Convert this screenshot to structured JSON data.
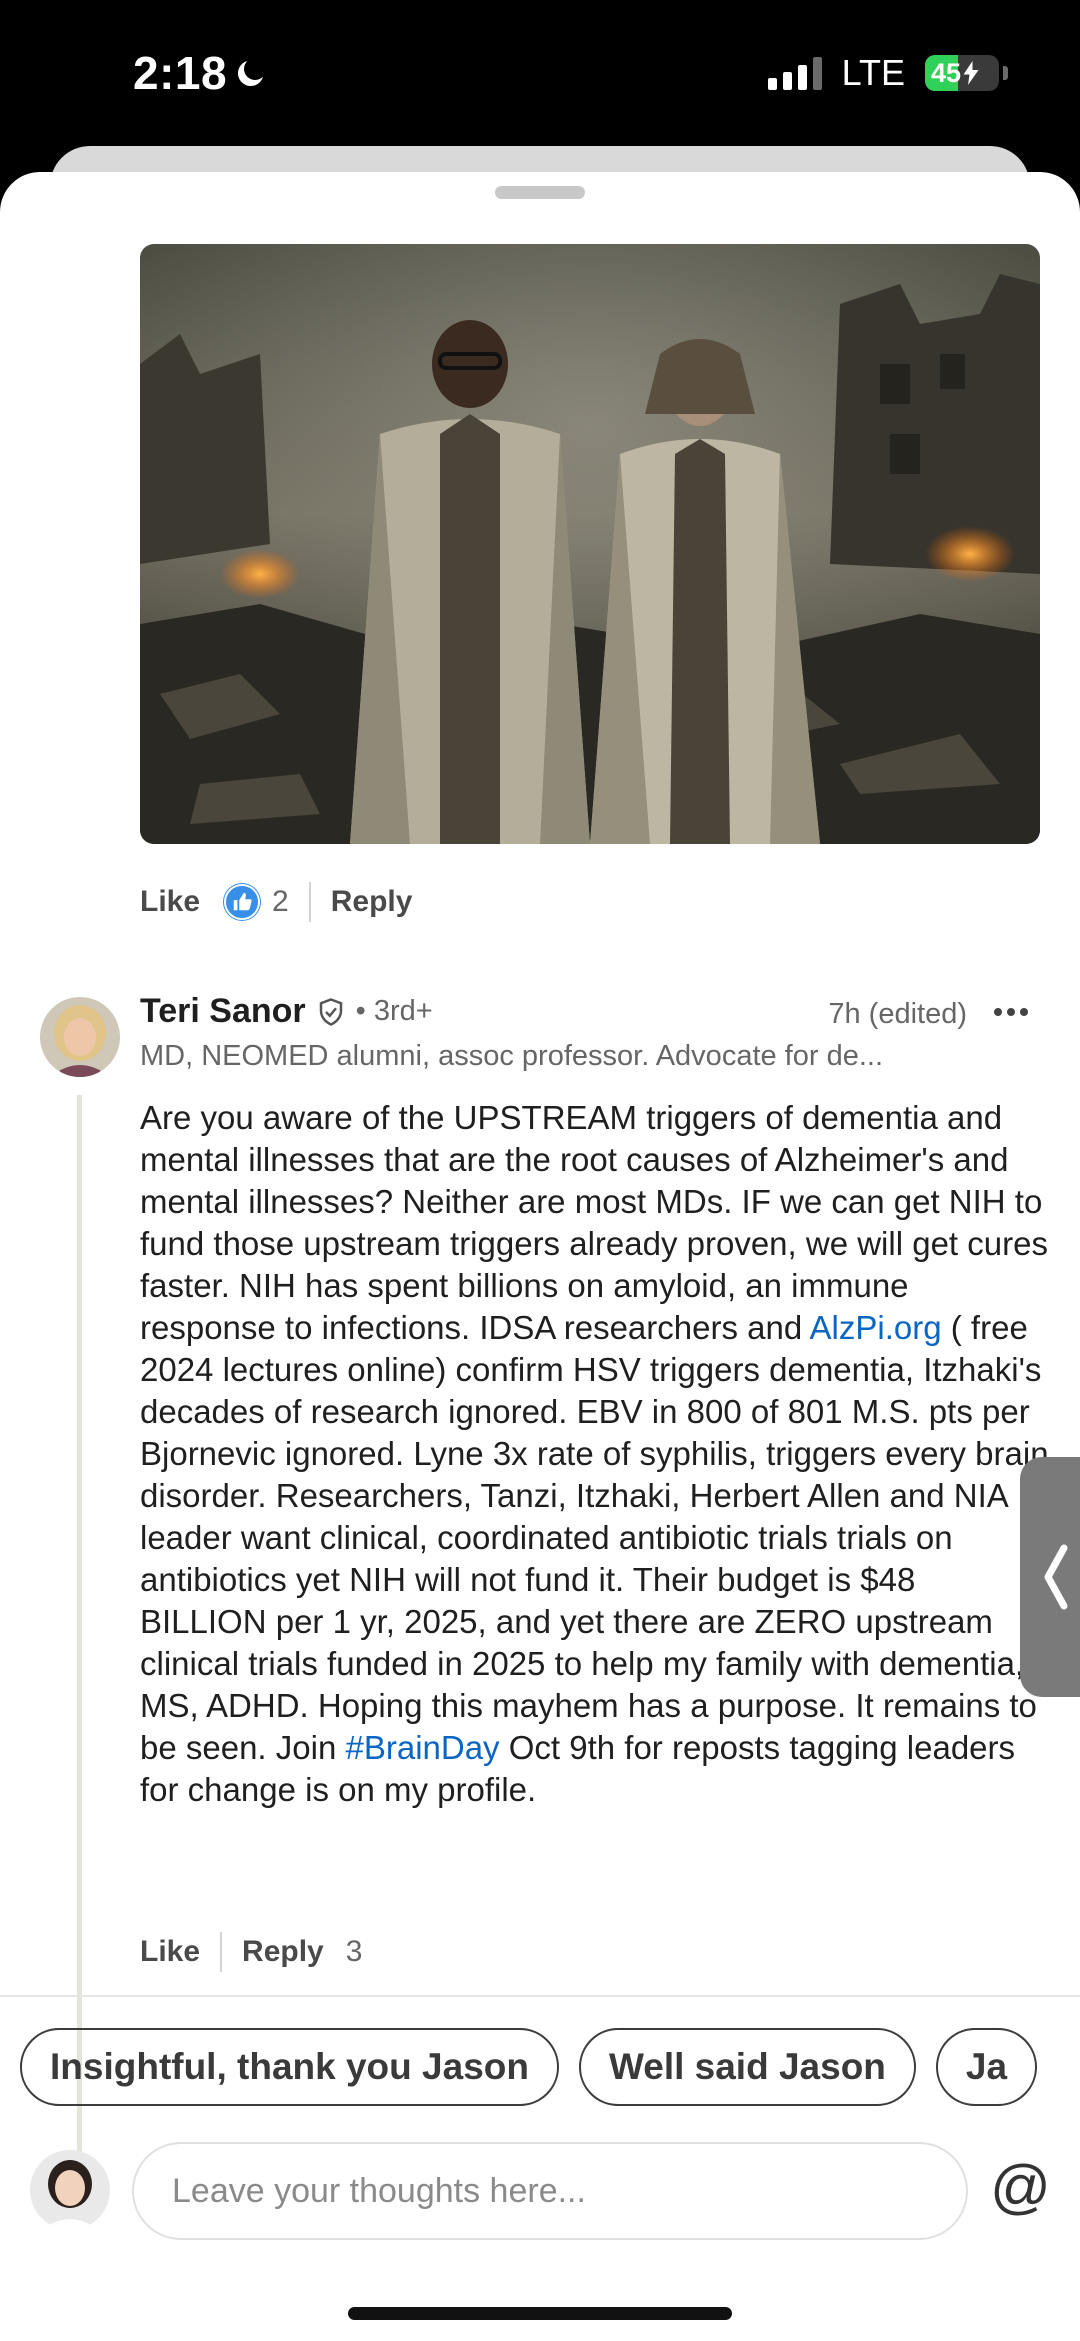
{
  "status_bar": {
    "time": "2:18",
    "network": "LTE",
    "battery": "45",
    "battery_level": 0.45
  },
  "previous_comment": {
    "like_label": "Like",
    "reaction_count": "2",
    "reply_label": "Reply"
  },
  "comment": {
    "author": "Teri Sanor",
    "degree": "• 3rd+",
    "timestamp": "7h (edited)",
    "headline": "MD, NEOMED alumni, assoc professor. Advocate for de...",
    "text_part1": "Are you aware of the UPSTREAM triggers of dementia and mental illnesses that are the root causes of Alzheimer's and mental illnesses? Neither are most MDs. IF we can get NIH to fund those upstream triggers already proven, we will get cures faster. NIH has spent billions on amyloid, an immune response to infections. IDSA researchers and ",
    "link1": "AlzPi.org",
    "text_part2": " ( free 2024 lectures online) confirm HSV triggers dementia, Itzhaki's decades of research ignored. EBV in 800 of 801 M.S. pts per Bjornevic ignored. Lyne 3x rate of syphilis, triggers every brain disorder.  Researchers, Tanzi, Itzhaki, Herbert Allen and NIA leader want clinical, coordinated antibiotic trials  trials on antibiotics yet NIH will not fund it. Their budget is $48 BILLION per 1 yr, 2025, and yet there are ZERO upstream clinical trials funded in 2025 to help my family with dementia, MS, ADHD. Hoping this mayhem has a purpose. It remains to be seen. Join ",
    "link2": "#BrainDay",
    "text_part3": " Oct 9th for reposts tagging leaders for change is on my profile.",
    "like_label": "Like",
    "reply_label": "Reply",
    "reply_count": "3"
  },
  "suggestions": [
    "Insightful, thank you Jason",
    "Well said Jason",
    "Ja"
  ],
  "composer": {
    "placeholder": "Leave your thoughts here...",
    "mention_symbol": "@"
  },
  "colors": {
    "link": "#0a66c2",
    "like_blue": "#378fe9",
    "battery_green": "#30d158"
  },
  "icons": [
    "moon-icon",
    "signal-icon",
    "battery-icon",
    "like-reaction-icon",
    "verified-shield-icon",
    "more-icon",
    "chevron-left-icon",
    "at-icon"
  ]
}
